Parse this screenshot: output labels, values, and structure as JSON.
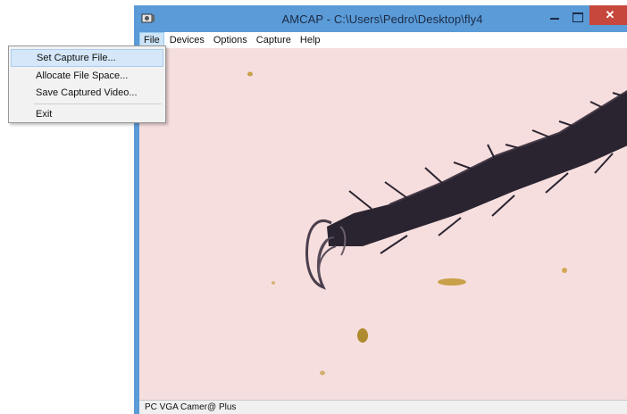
{
  "window": {
    "title": "AMCAP - C:\\Users\\Pedro\\Desktop\\fly4",
    "close_glyph": "✕",
    "app_icon": "camera-icon"
  },
  "menubar": {
    "items": [
      "File",
      "Devices",
      "Options",
      "Capture",
      "Help"
    ],
    "active": "File"
  },
  "file_menu": {
    "items": [
      "Set Capture File...",
      "Allocate File Space...",
      "Save Captured Video...",
      "Exit"
    ],
    "highlighted": "Set Capture File..."
  },
  "statusbar": {
    "text": "PC VGA Camer@ Plus"
  },
  "colors": {
    "titlebar": "#5a9bd8",
    "close_button": "#c7473c",
    "viewport": "#f7dede",
    "specimen": "#2a2430"
  }
}
